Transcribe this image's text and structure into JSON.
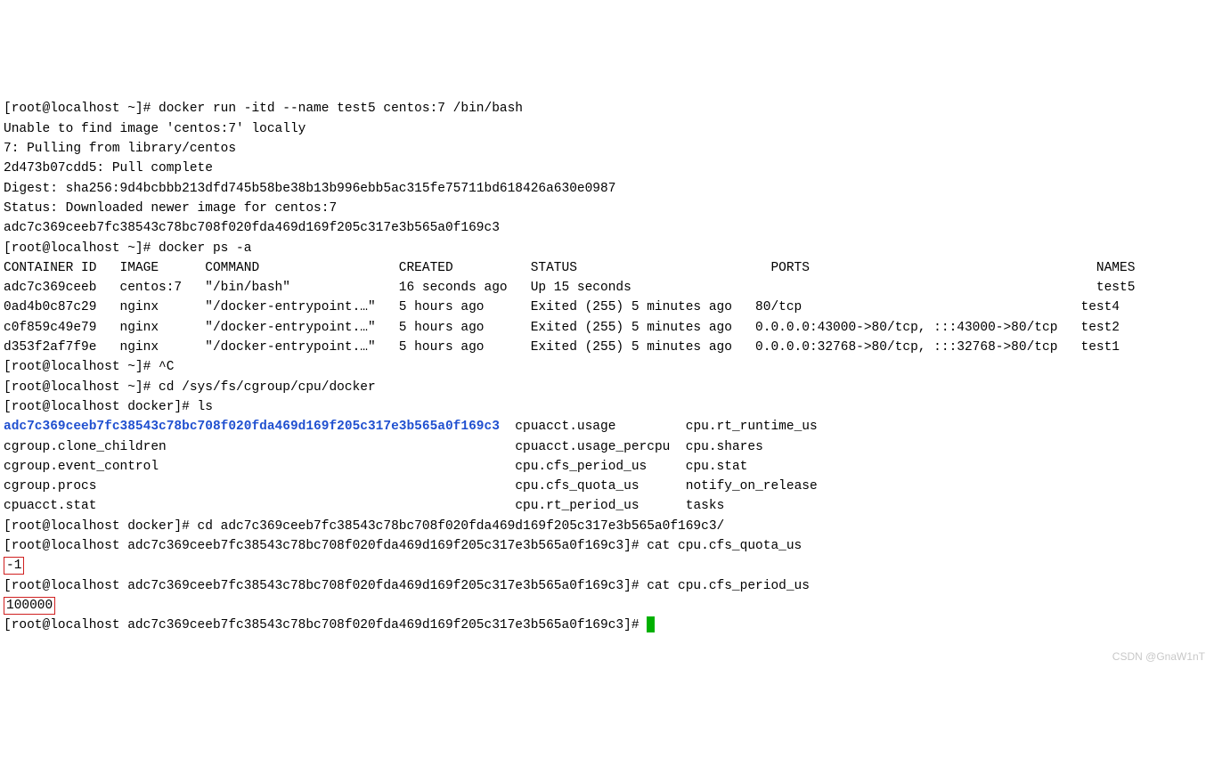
{
  "lines": {
    "l01": "[root@localhost ~]# docker run -itd --name test5 centos:7 /bin/bash",
    "l02": "Unable to find image 'centos:7' locally",
    "l03": "7: Pulling from library/centos",
    "l04": "2d473b07cdd5: Pull complete",
    "l05": "Digest: sha256:9d4bcbbb213dfd745b58be38b13b996ebb5ac315fe75711bd618426a630e0987",
    "l06": "Status: Downloaded newer image for centos:7",
    "l07": "adc7c369ceeb7fc38543c78bc708f020fda469d169f205c317e3b565a0f169c3",
    "l08": "[root@localhost ~]# docker ps -a",
    "l09": "CONTAINER ID   IMAGE      COMMAND                  CREATED          STATUS                         PORTS                                     NAMES",
    "l10": "adc7c369ceeb   centos:7   \"/bin/bash\"              16 seconds ago   Up 15 seconds                                                            test5",
    "l11": "0ad4b0c87c29   nginx      \"/docker-entrypoint.…\"   5 hours ago      Exited (255) 5 minutes ago   80/tcp                                    test4",
    "l12": "c0f859c49e79   nginx      \"/docker-entrypoint.…\"   5 hours ago      Exited (255) 5 minutes ago   0.0.0.0:43000->80/tcp, :::43000->80/tcp   test2",
    "l13": "d353f2af7f9e   nginx      \"/docker-entrypoint.…\"   5 hours ago      Exited (255) 5 minutes ago   0.0.0.0:32768->80/tcp, :::32768->80/tcp   test1",
    "l14": "[root@localhost ~]# ^C",
    "l15": "[root@localhost ~]# cd /sys/fs/cgroup/cpu/docker",
    "l16": "[root@localhost docker]# ls",
    "ls_dir": "adc7c369ceeb7fc38543c78bc708f020fda469d169f205c317e3b565a0f169c3",
    "ls_r1c2": "cpuacct.usage",
    "ls_r1c3": "cpu.rt_runtime_us",
    "ls_r2c1": "cgroup.clone_children",
    "ls_r2c2": "cpuacct.usage_percpu",
    "ls_r2c3": "cpu.shares",
    "ls_r3c1": "cgroup.event_control",
    "ls_r3c2": "cpu.cfs_period_us",
    "ls_r3c3": "cpu.stat",
    "ls_r4c1": "cgroup.procs",
    "ls_r4c2": "cpu.cfs_quota_us",
    "ls_r4c3": "notify_on_release",
    "ls_r5c1": "cpuacct.stat",
    "ls_r5c2": "cpu.rt_period_us",
    "ls_r5c3": "tasks",
    "l22": "[root@localhost docker]# cd adc7c369ceeb7fc38543c78bc708f020fda469d169f205c317e3b565a0f169c3/",
    "l23": "[root@localhost adc7c369ceeb7fc38543c78bc708f020fda469d169f205c317e3b565a0f169c3]# cat cpu.cfs_quota_us",
    "l24": "-1",
    "l25": "[root@localhost adc7c369ceeb7fc38543c78bc708f020fda469d169f205c317e3b565a0f169c3]# cat cpu.cfs_period_us",
    "l26": "100000",
    "l27": "[root@localhost adc7c369ceeb7fc38543c78bc708f020fda469d169f205c317e3b565a0f169c3]# "
  },
  "watermark": "CSDN @GnaW1nT"
}
